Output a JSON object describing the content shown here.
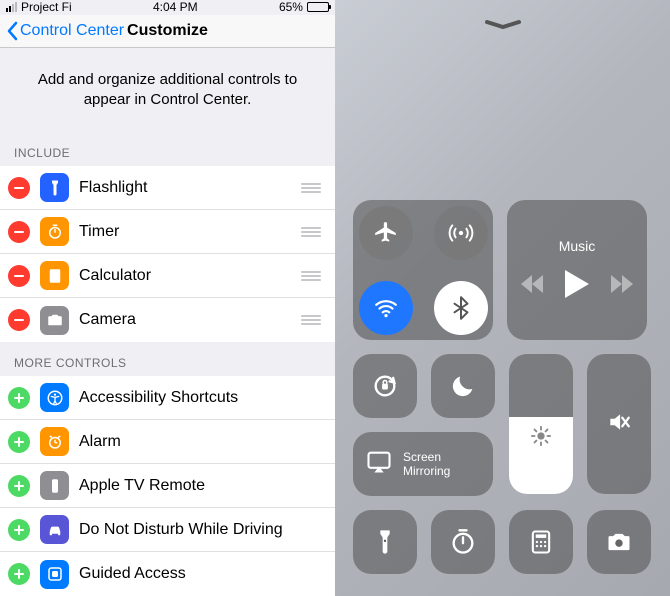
{
  "status": {
    "carrier": "Project Fi",
    "time": "4:04 PM",
    "battery_pct": "65%"
  },
  "nav": {
    "back": "Control Center",
    "title": "Customize"
  },
  "description": "Add and organize additional controls to appear in Control Center.",
  "sections": {
    "include_header": "INCLUDE",
    "more_header": "MORE CONTROLS"
  },
  "include": [
    {
      "label": "Flashlight",
      "icon": "flashlight",
      "color": "#2362ff"
    },
    {
      "label": "Timer",
      "icon": "timer",
      "color": "#ff9500"
    },
    {
      "label": "Calculator",
      "icon": "calculator",
      "color": "#ff9500"
    },
    {
      "label": "Camera",
      "icon": "camera",
      "color": "#8e8e93"
    }
  ],
  "more": [
    {
      "label": "Accessibility Shortcuts",
      "icon": "accessibility",
      "color": "#007aff"
    },
    {
      "label": "Alarm",
      "icon": "alarm",
      "color": "#ff9500"
    },
    {
      "label": "Apple TV Remote",
      "icon": "remote",
      "color": "#8e8e93"
    },
    {
      "label": "Do Not Disturb While Driving",
      "icon": "car",
      "color": "#5856d6"
    },
    {
      "label": "Guided Access",
      "icon": "guided",
      "color": "#007aff"
    }
  ],
  "cc": {
    "music_label": "Music",
    "screen_mirroring": "Screen Mirroring"
  }
}
